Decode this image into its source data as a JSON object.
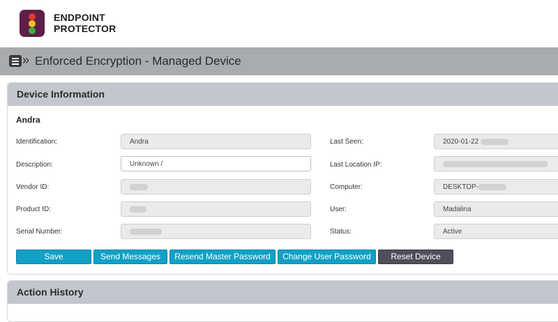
{
  "brand": {
    "line1": "ENDPOINT",
    "line2": "PROTECTOR"
  },
  "page": {
    "title": "Enforced Encryption - Managed Device"
  },
  "device_panel": {
    "title": "Device Information",
    "device_name": "Andra",
    "left_fields": [
      {
        "label": "Identification:",
        "value": "Andra",
        "editable": false
      },
      {
        "label": "Description:",
        "value": "Unknown /",
        "editable": true
      },
      {
        "label": "Vendor ID:",
        "value": "",
        "editable": false
      },
      {
        "label": "Product ID:",
        "value": "",
        "editable": false
      },
      {
        "label": "Serial Number:",
        "value": "",
        "editable": false
      }
    ],
    "right_fields": [
      {
        "label": "Last Seen:",
        "value": "2020-01-22"
      },
      {
        "label": "Last Location IP:",
        "value": ""
      },
      {
        "label": "Computer:",
        "value": "DESKTOP-"
      },
      {
        "label": "User:",
        "value": "Madalina"
      },
      {
        "label": "Status:",
        "value": "Active"
      }
    ],
    "buttons": {
      "save": "Save",
      "send_messages": "Send Messages",
      "resend_master_password": "Resend Master Password",
      "change_user_password": "Change User Password",
      "reset_device": "Reset Device"
    }
  },
  "history_panel": {
    "title": "Action History"
  },
  "colors": {
    "button_primary": "#12a0c6",
    "button_dark": "#4f4f5c",
    "header_bar": "#a9acaf",
    "panel_header": "#c3c6cc",
    "logo_bg": "#5e1f48"
  }
}
